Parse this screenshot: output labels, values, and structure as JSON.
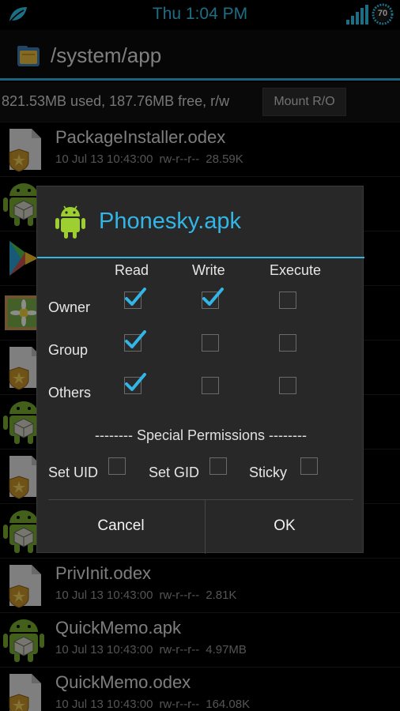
{
  "status_bar": {
    "time": "Thu 1:04 PM",
    "battery_level": "70",
    "icons": [
      "leaf-icon",
      "signal-icon",
      "battery-icon"
    ],
    "accent_color": "#33c9f0"
  },
  "action_bar": {
    "path": "/system/app",
    "icon": "file-manager-icon",
    "accent_color": "#33b5e5"
  },
  "info_bar": {
    "usage": "821.53MB used, 187.76MB free, r/w",
    "mount_button": "Mount R/O"
  },
  "files": [
    {
      "name": "PackageInstaller.odex",
      "date": "10 Jul 13 10:43:00",
      "perms": "rw-r--r--",
      "size": "28.59K",
      "icon": "odex-file-icon"
    },
    {
      "name": "",
      "date": "",
      "perms": "",
      "size": "",
      "icon": "android-apk-icon"
    },
    {
      "name": "",
      "date": "",
      "perms": "",
      "size": "",
      "icon": "play-store-icon"
    },
    {
      "name": "",
      "date": "",
      "perms": "",
      "size": "",
      "icon": "gallery-icon"
    },
    {
      "name": "",
      "date": "",
      "perms": "",
      "size": "",
      "icon": "odex-file-icon"
    },
    {
      "name": "",
      "date": "",
      "perms": "",
      "size": "",
      "icon": "android-apk-icon"
    },
    {
      "name": "",
      "date": "",
      "perms": "",
      "size": "",
      "icon": "odex-file-icon"
    },
    {
      "name": "",
      "date": "",
      "perms": "",
      "size": "",
      "icon": "android-apk-icon"
    },
    {
      "name": "PrivInit.odex",
      "date": "10 Jul 13 10:43:00",
      "perms": "rw-r--r--",
      "size": "2.81K",
      "icon": "odex-file-icon"
    },
    {
      "name": "QuickMemo.apk",
      "date": "10 Jul 13 10:43:00",
      "perms": "rw-r--r--",
      "size": "4.97MB",
      "icon": "android-apk-icon"
    },
    {
      "name": "QuickMemo.odex",
      "date": "10 Jul 13 10:43:00",
      "perms": "rw-r--r--",
      "size": "164.08K",
      "icon": "odex-file-icon"
    }
  ],
  "dialog": {
    "title": "Phonesky.apk",
    "title_icon": "android-icon",
    "columns": [
      "Read",
      "Write",
      "Execute"
    ],
    "rows": [
      {
        "label": "Owner",
        "checked": [
          true,
          true,
          false
        ]
      },
      {
        "label": "Group",
        "checked": [
          true,
          false,
          false
        ]
      },
      {
        "label": "Others",
        "checked": [
          true,
          false,
          false
        ]
      }
    ],
    "special_heading": "-------- Special Permissions --------",
    "special": [
      {
        "label": "Set UID",
        "checked": false
      },
      {
        "label": "Set GID",
        "checked": false
      },
      {
        "label": "Sticky",
        "checked": false
      }
    ],
    "cancel_label": "Cancel",
    "ok_label": "OK"
  }
}
